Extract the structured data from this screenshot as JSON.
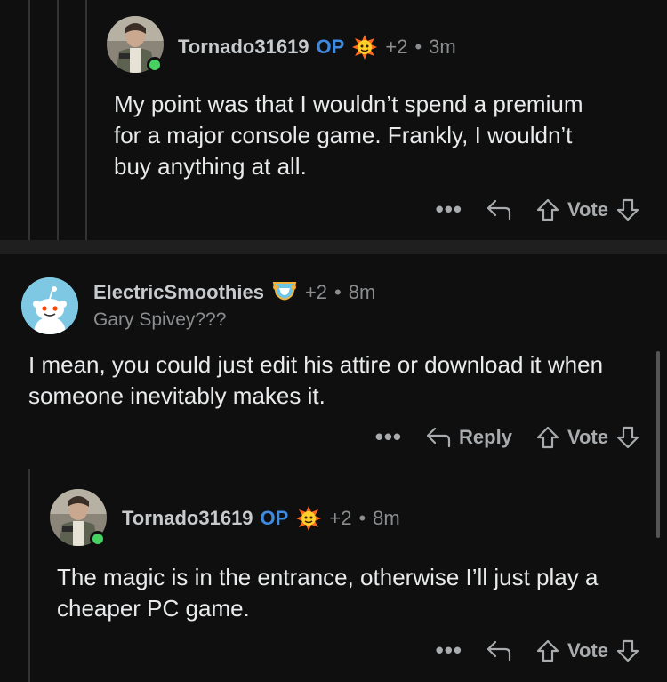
{
  "comments": [
    {
      "username": "Tornado31619",
      "op_label": "OP",
      "score": "+2",
      "time": "3m",
      "body": "My point was that I wouldn’t spend a premium for a major console game. Frankly, I wouldn’t buy anything at all.",
      "actions": {
        "more": "•••",
        "vote": "Vote"
      }
    },
    {
      "username": "ElectricSmoothies",
      "score": "+2",
      "time": "8m",
      "flair": "Gary Spivey???",
      "body": "I mean, you could just edit his attire or download it when someone inevitably makes it.",
      "actions": {
        "more": "•••",
        "reply": "Reply",
        "vote": "Vote"
      }
    },
    {
      "username": "Tornado31619",
      "op_label": "OP",
      "score": "+2",
      "time": "8m",
      "body": "The magic is in the entrance, otherwise I’ll just play a cheaper PC game.",
      "actions": {
        "more": "•••",
        "vote": "Vote"
      }
    }
  ],
  "separator": "•",
  "colors": {
    "background": "#0f0f0f",
    "op": "#3f8ae0",
    "online": "#46d160",
    "snoo": "#7ec8e3"
  }
}
